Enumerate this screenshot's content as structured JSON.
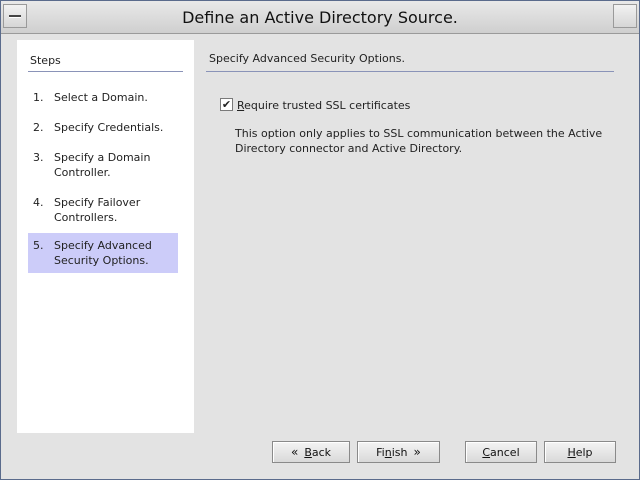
{
  "window": {
    "title": "Define an Active Directory Source."
  },
  "steps": {
    "heading": "Steps",
    "items": [
      {
        "num": "1.",
        "label": "Select a Domain."
      },
      {
        "num": "2.",
        "label": "Specify Credentials."
      },
      {
        "num": "3.",
        "label": "Specify a Domain Controller."
      },
      {
        "num": "4.",
        "label": "Specify Failover Controllers."
      },
      {
        "num": "5.",
        "label": "Specify Advanced Security Options."
      }
    ],
    "active_index": 4
  },
  "main": {
    "heading": "Specify Advanced Security Options.",
    "checkbox": {
      "checked": true,
      "mark": "✔",
      "label_mnemonic": "R",
      "label_rest": "equire trusted SSL certificates"
    },
    "note": "This option only applies to SSL communication between the Active Directory connector and Active Directory."
  },
  "buttons": {
    "back": {
      "mnemonic": "B",
      "rest": "ack",
      "icon": "«"
    },
    "finish": {
      "pre": "Fi",
      "mnemonic": "n",
      "rest": "ish",
      "icon": "»"
    },
    "cancel": {
      "mnemonic": "C",
      "rest": "ancel"
    },
    "help": {
      "mnemonic": "H",
      "rest": "elp"
    }
  }
}
